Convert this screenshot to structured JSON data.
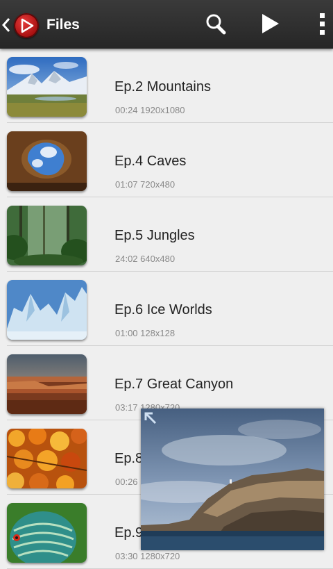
{
  "header": {
    "title": "Files",
    "icons": [
      "back-icon",
      "app-logo-icon",
      "search-icon",
      "play-icon",
      "overflow-menu-icon"
    ]
  },
  "files": [
    {
      "title": "Ep.2 Mountains",
      "duration": "00:24",
      "resolution": "1920x1080"
    },
    {
      "title": "Ep.4 Caves",
      "duration": "01:07",
      "resolution": "720x480"
    },
    {
      "title": "Ep.5 Jungles",
      "duration": "24:02",
      "resolution": "640x480"
    },
    {
      "title": "Ep.6 Ice Worlds",
      "duration": "01:00",
      "resolution": "128x128"
    },
    {
      "title": "Ep.7 Great Canyon",
      "duration": "03:17",
      "resolution": "1280x720"
    },
    {
      "title": "Ep.8",
      "duration": "00:26",
      "resolution": ""
    },
    {
      "title": "Ep.9",
      "duration": "03:30",
      "resolution": "1280x720"
    }
  ],
  "popup_player": {
    "icon": "expand-icon"
  }
}
